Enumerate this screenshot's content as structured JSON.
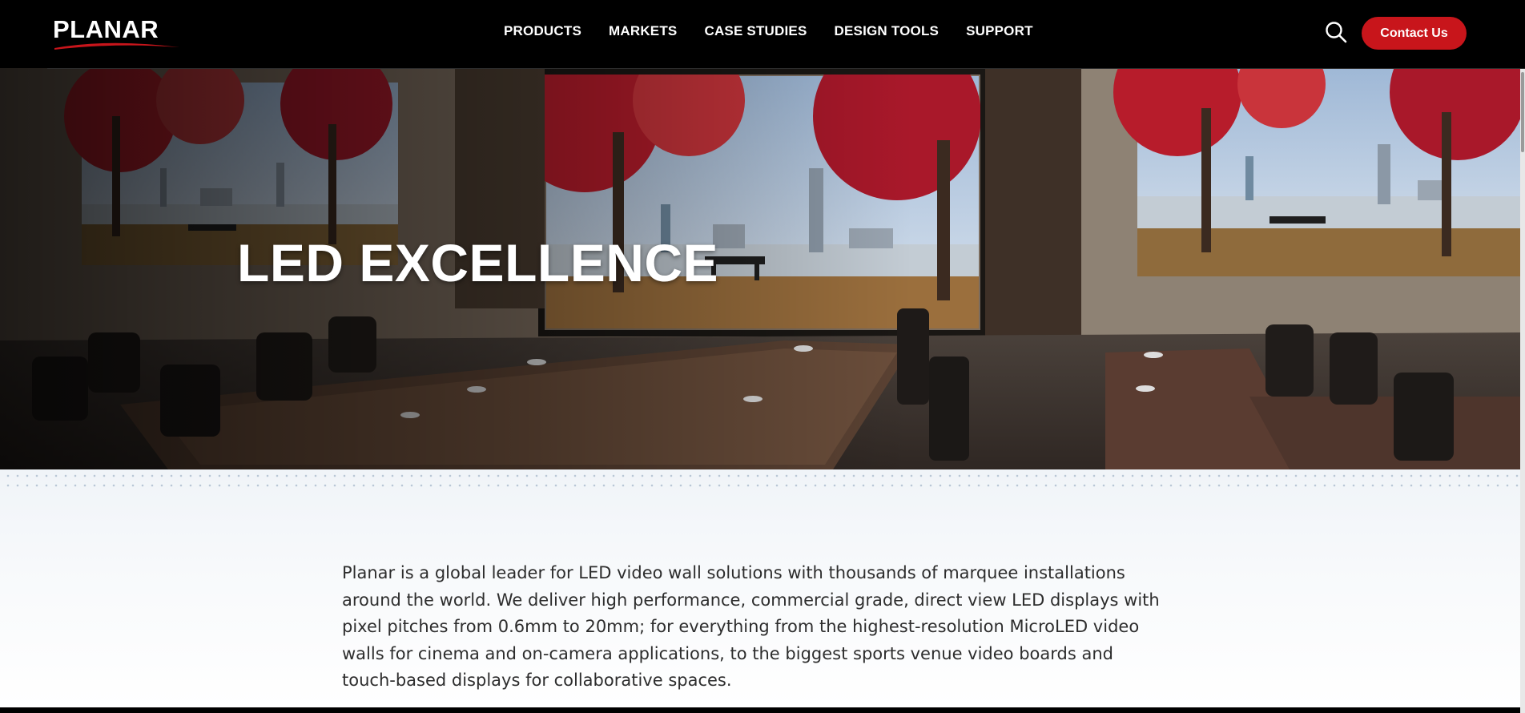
{
  "brand": {
    "logo_text": "PLANAR",
    "accent_color": "#c8151b"
  },
  "nav": {
    "items": [
      {
        "label": "PRODUCTS"
      },
      {
        "label": "MARKETS"
      },
      {
        "label": "CASE STUDIES"
      },
      {
        "label": "DESIGN TOOLS"
      },
      {
        "label": "SUPPORT"
      }
    ],
    "search_icon": "search-icon",
    "contact_label": "Contact Us"
  },
  "hero": {
    "title": "LED EXCELLENCE"
  },
  "intro": {
    "text": "Planar is a global leader for LED video wall solutions with thousands of marquee installations around the world. We deliver high performance, commercial grade, direct view LED displays with pixel pitches from 0.6mm to 20mm; for everything from the highest-resolution MicroLED video walls for cinema and on-camera applications, to the biggest sports venue video boards and touch-based displays for collaborative spaces."
  }
}
